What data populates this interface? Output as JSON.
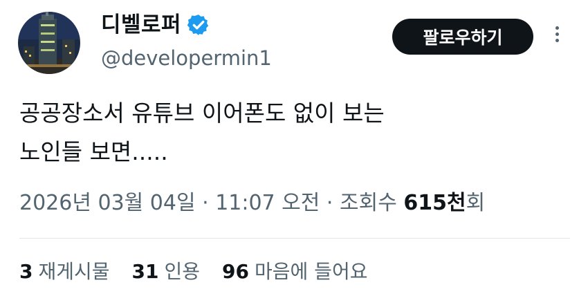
{
  "author": {
    "display_name": "디벨로퍼",
    "handle": "@developermin1",
    "verified": true
  },
  "actions": {
    "follow_label": "팔로우하기"
  },
  "tweet": {
    "lines": [
      "공공장소서 유튜브 이어폰도 없이 보는",
      "노인들 보면....."
    ]
  },
  "meta": {
    "date": "2026년 03월 04일",
    "separator": " · ",
    "time": "11:07 오전",
    "views_label": "조회수",
    "views_value": "615천",
    "views_suffix": "회"
  },
  "stats": [
    {
      "count": "3",
      "label": "재게시물"
    },
    {
      "count": "31",
      "label": "인용"
    },
    {
      "count": "96",
      "label": "마음에 들어요"
    }
  ],
  "colors": {
    "text": "#0f1419",
    "secondary": "#536471",
    "verified_badge": "#1d9bf0",
    "button_bg": "#0f1419",
    "divider": "#e1e6ea"
  },
  "icons": {
    "verified": "verified-badge-icon",
    "more": "more-dots-vertical-icon"
  }
}
